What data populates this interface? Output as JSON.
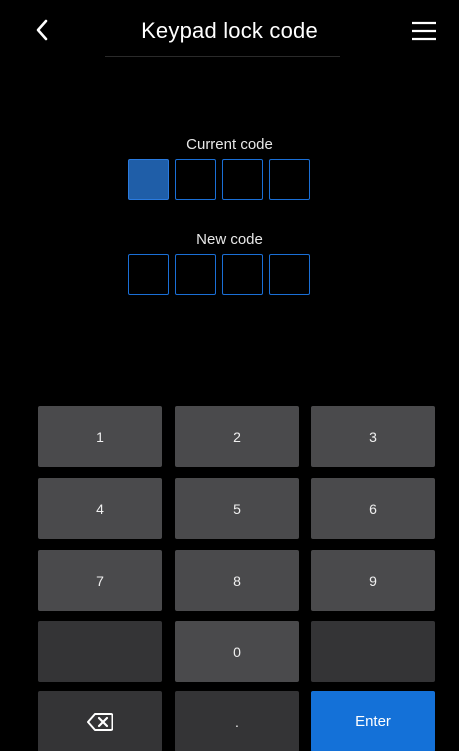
{
  "header": {
    "title": "Keypad lock code",
    "back_icon": "chevron-left-icon",
    "menu_icon": "hamburger-menu-icon"
  },
  "current_code": {
    "label": "Current code",
    "digits": 4,
    "active_index": 0
  },
  "new_code": {
    "label": "New code",
    "digits": 4
  },
  "keypad": {
    "keys": [
      "1",
      "2",
      "3",
      "4",
      "5",
      "6",
      "7",
      "8",
      "9",
      "",
      "0",
      ""
    ],
    "backspace_icon": "backspace-icon",
    "dot_label": ".",
    "enter_label": "Enter"
  },
  "colors": {
    "background": "#000000",
    "accent": "#1471d8",
    "key": "#4a4a4c",
    "key_dark": "#343436"
  }
}
